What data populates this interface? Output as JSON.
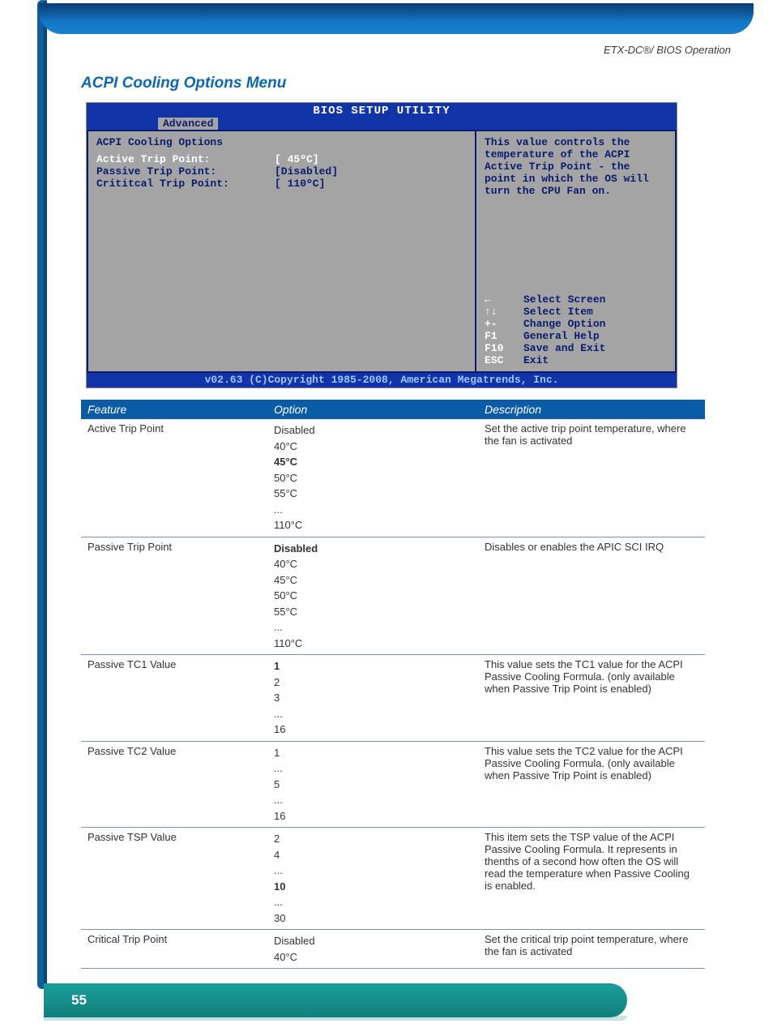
{
  "header": {
    "doc_title_right": "ETX-DC®/ BIOS Operation",
    "section_title": "ACPI Cooling Options Menu"
  },
  "bios": {
    "title": "BIOS SETUP UTILITY",
    "active_tab": "Advanced",
    "panel_heading": "ACPI Cooling Options",
    "rows": [
      {
        "label": "Active Trip Point:",
        "value": "[ 45ºC]",
        "selected": true
      },
      {
        "label": "Passive Trip Point:",
        "value": "[Disabled]",
        "selected": false
      },
      {
        "label": "Crititcal Trip Point:",
        "value": "[ 110ºC]",
        "selected": false
      }
    ],
    "help_text": "This value controls the temperature of the ACPI Active Trip Point - the point in which the OS will turn the CPU Fan on.",
    "nav": [
      {
        "key": "←",
        "desc": "Select Screen"
      },
      {
        "key": "↑↓",
        "desc": "Select Item"
      },
      {
        "key": "+-",
        "desc": "Change Option"
      },
      {
        "key": "F1",
        "desc": "General Help"
      },
      {
        "key": "F10",
        "desc": "Save and Exit"
      },
      {
        "key": "ESC",
        "desc": "Exit"
      }
    ],
    "footer": "v02.63 (C)Copyright 1985-2008, American Megatrends, Inc."
  },
  "table": {
    "headers": {
      "feature": "Feature",
      "option": "Option",
      "description": "Description"
    },
    "rows": [
      {
        "feature": "Active Trip Point",
        "options": [
          "Disabled",
          "40°C",
          "45°C",
          "50°C",
          "55°C",
          "...",
          "110°C"
        ],
        "bold_index": 2,
        "description": "Set the active trip point temperature, where the fan is activated"
      },
      {
        "feature": "Passive Trip Point",
        "options": [
          "Disabled",
          "40°C",
          "45°C",
          "50°C",
          "55°C",
          "...",
          "110°C"
        ],
        "bold_index": 0,
        "description": "Disables or enables the APIC SCI IRQ"
      },
      {
        "feature": "Passive TC1 Value",
        "options": [
          "1",
          "2",
          "3",
          "...",
          "16"
        ],
        "bold_index": 0,
        "description": "This value sets the TC1 value for the ACPI Passive Cooling Formula. (only available when Passive Trip Point is enabled)"
      },
      {
        "feature": "Passive TC2 Value",
        "options": [
          "1",
          "...",
          "5",
          "...",
          "16"
        ],
        "bold_index": -1,
        "description": "This value sets the TC2 value for the ACPI Passive Cooling Formula. (only available when Passive Trip Point is enabled)"
      },
      {
        "feature": "Passive TSP Value",
        "options": [
          "2",
          "4",
          "...",
          "10",
          "...",
          "30"
        ],
        "bold_index": 3,
        "description": "This item sets the TSP value of the ACPI Passive Cooling Formula. It represents in thenths of a second how often the OS will read the temperature when Passive Cooling is enabled."
      },
      {
        "feature": "Critical Trip Point",
        "options": [
          "Disabled",
          "40°C"
        ],
        "bold_index": -1,
        "description": "Set the critical trip point temperature, where the fan is activated"
      }
    ]
  },
  "footer": {
    "page_number": "55"
  }
}
